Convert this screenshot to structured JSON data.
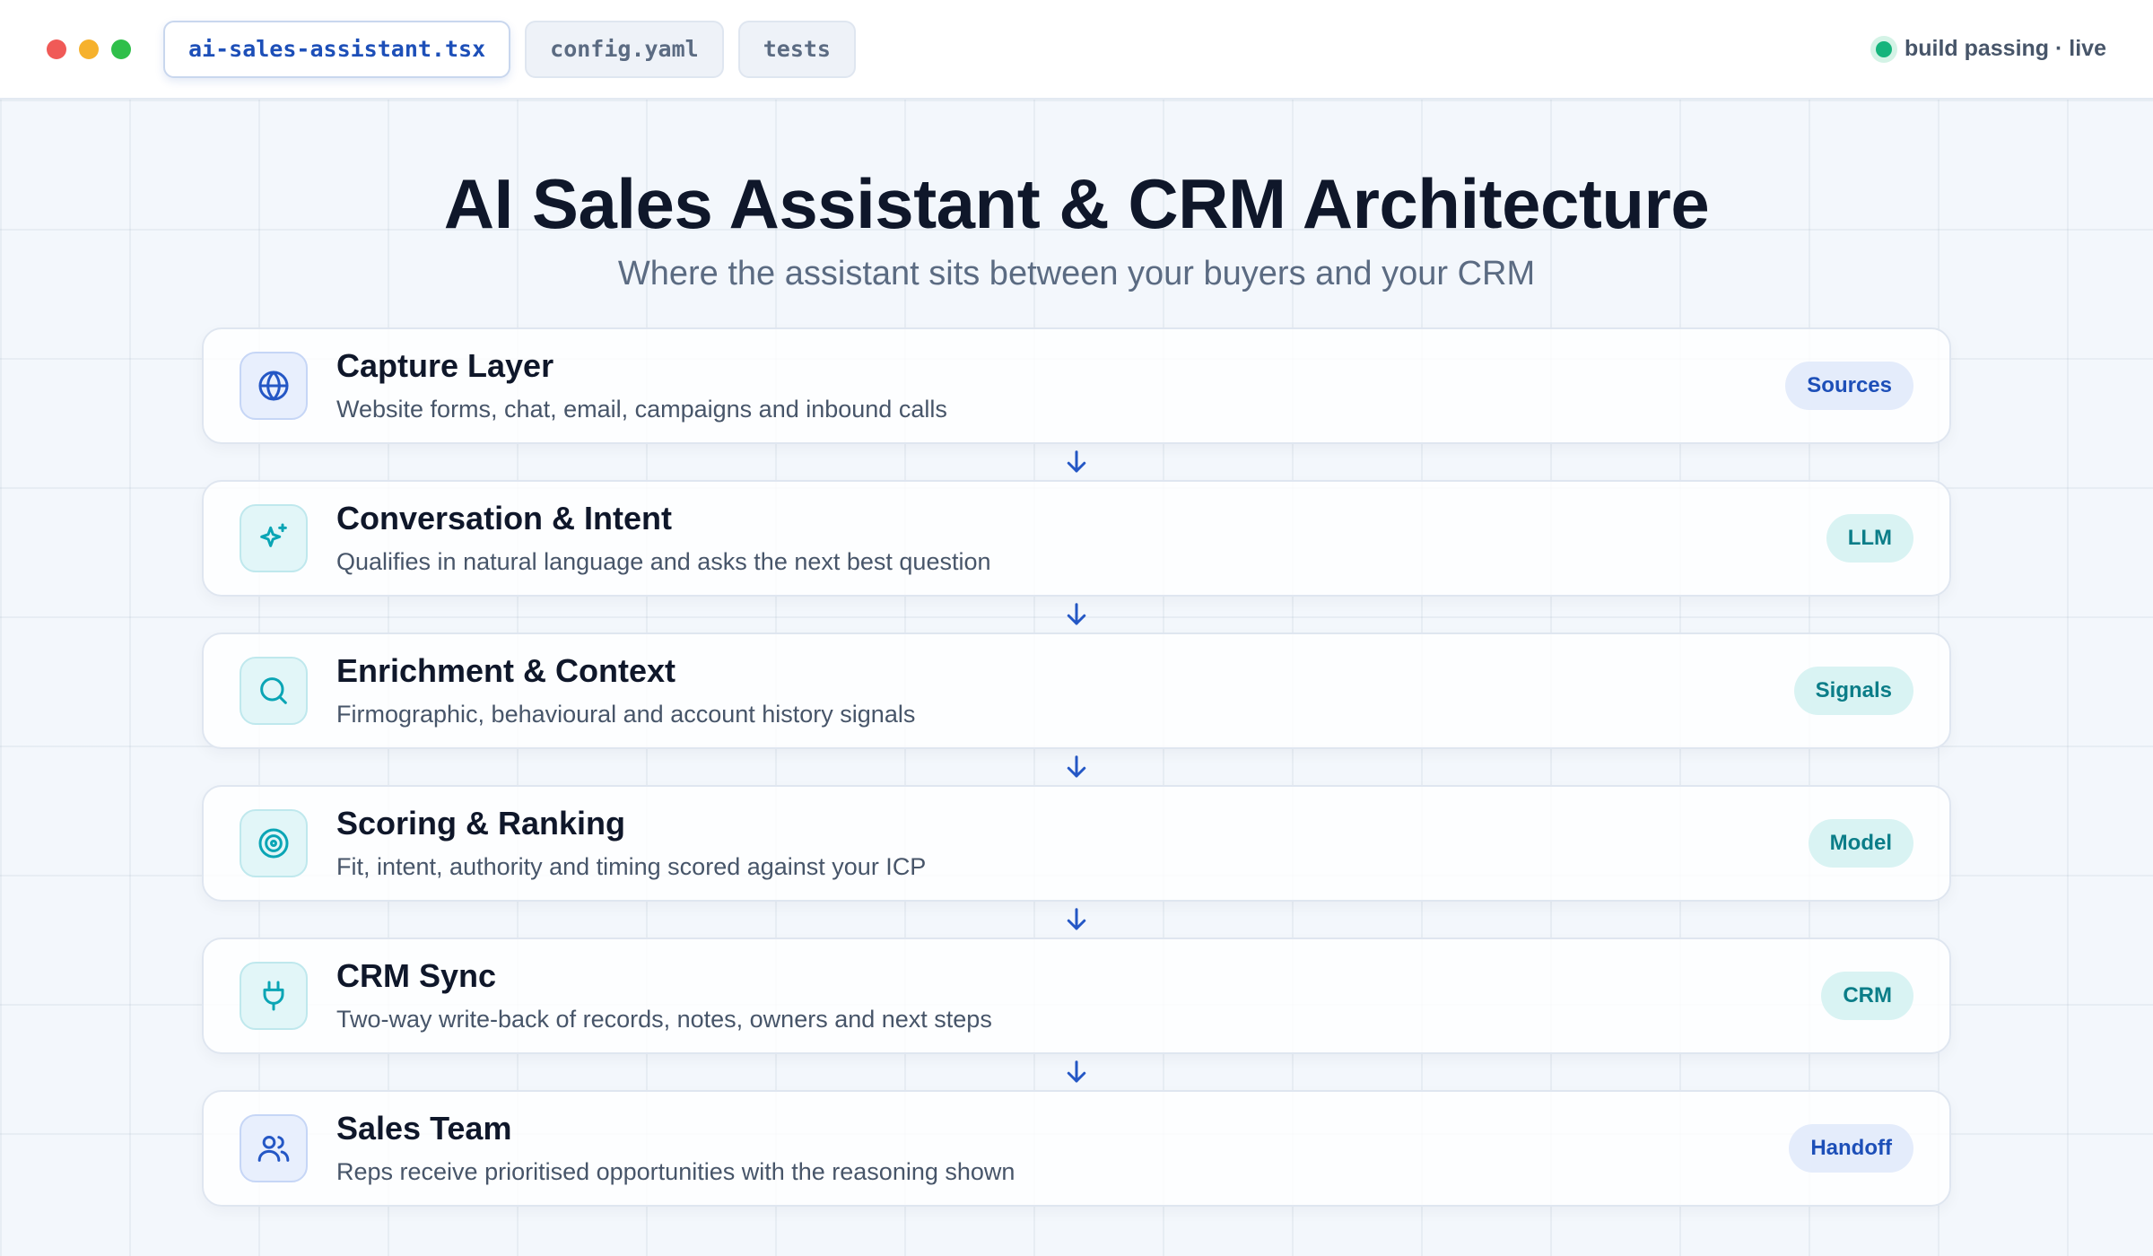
{
  "window": {
    "tabs": [
      {
        "label": "ai-sales-assistant.tsx",
        "active": true
      },
      {
        "label": "config.yaml",
        "active": false
      },
      {
        "label": "tests",
        "active": false
      }
    ],
    "status": "build passing · live",
    "status_color": "#16b47c"
  },
  "diagram": {
    "title": "AI Sales Assistant & CRM Architecture",
    "subtitle": "Where the assistant sits between your buyers and your CRM",
    "layers": [
      {
        "title": "Capture Layer",
        "description": "Website forms, chat, email, campaigns and inbound calls",
        "badge": "Sources",
        "icon": "globe-icon",
        "tone": "blue"
      },
      {
        "title": "Conversation & Intent",
        "description": "Qualifies in natural language and asks the next best question",
        "badge": "LLM",
        "icon": "sparkle-icon",
        "tone": "teal"
      },
      {
        "title": "Enrichment & Context",
        "description": "Firmographic, behavioural and account history signals",
        "badge": "Signals",
        "icon": "search-icon",
        "tone": "teal"
      },
      {
        "title": "Scoring & Ranking",
        "description": "Fit, intent, authority and timing scored against your ICP",
        "badge": "Model",
        "icon": "target-icon",
        "tone": "teal"
      },
      {
        "title": "CRM Sync",
        "description": "Two-way write-back of records, notes, owners and next steps",
        "badge": "CRM",
        "icon": "plug-icon",
        "tone": "teal"
      },
      {
        "title": "Sales Team",
        "description": "Reps receive prioritised opportunities with the reasoning shown",
        "badge": "Handoff",
        "icon": "users-icon",
        "tone": "blue"
      }
    ],
    "colors": {
      "accent_blue": "#2457c5",
      "accent_teal": "#0aa5b5"
    }
  }
}
